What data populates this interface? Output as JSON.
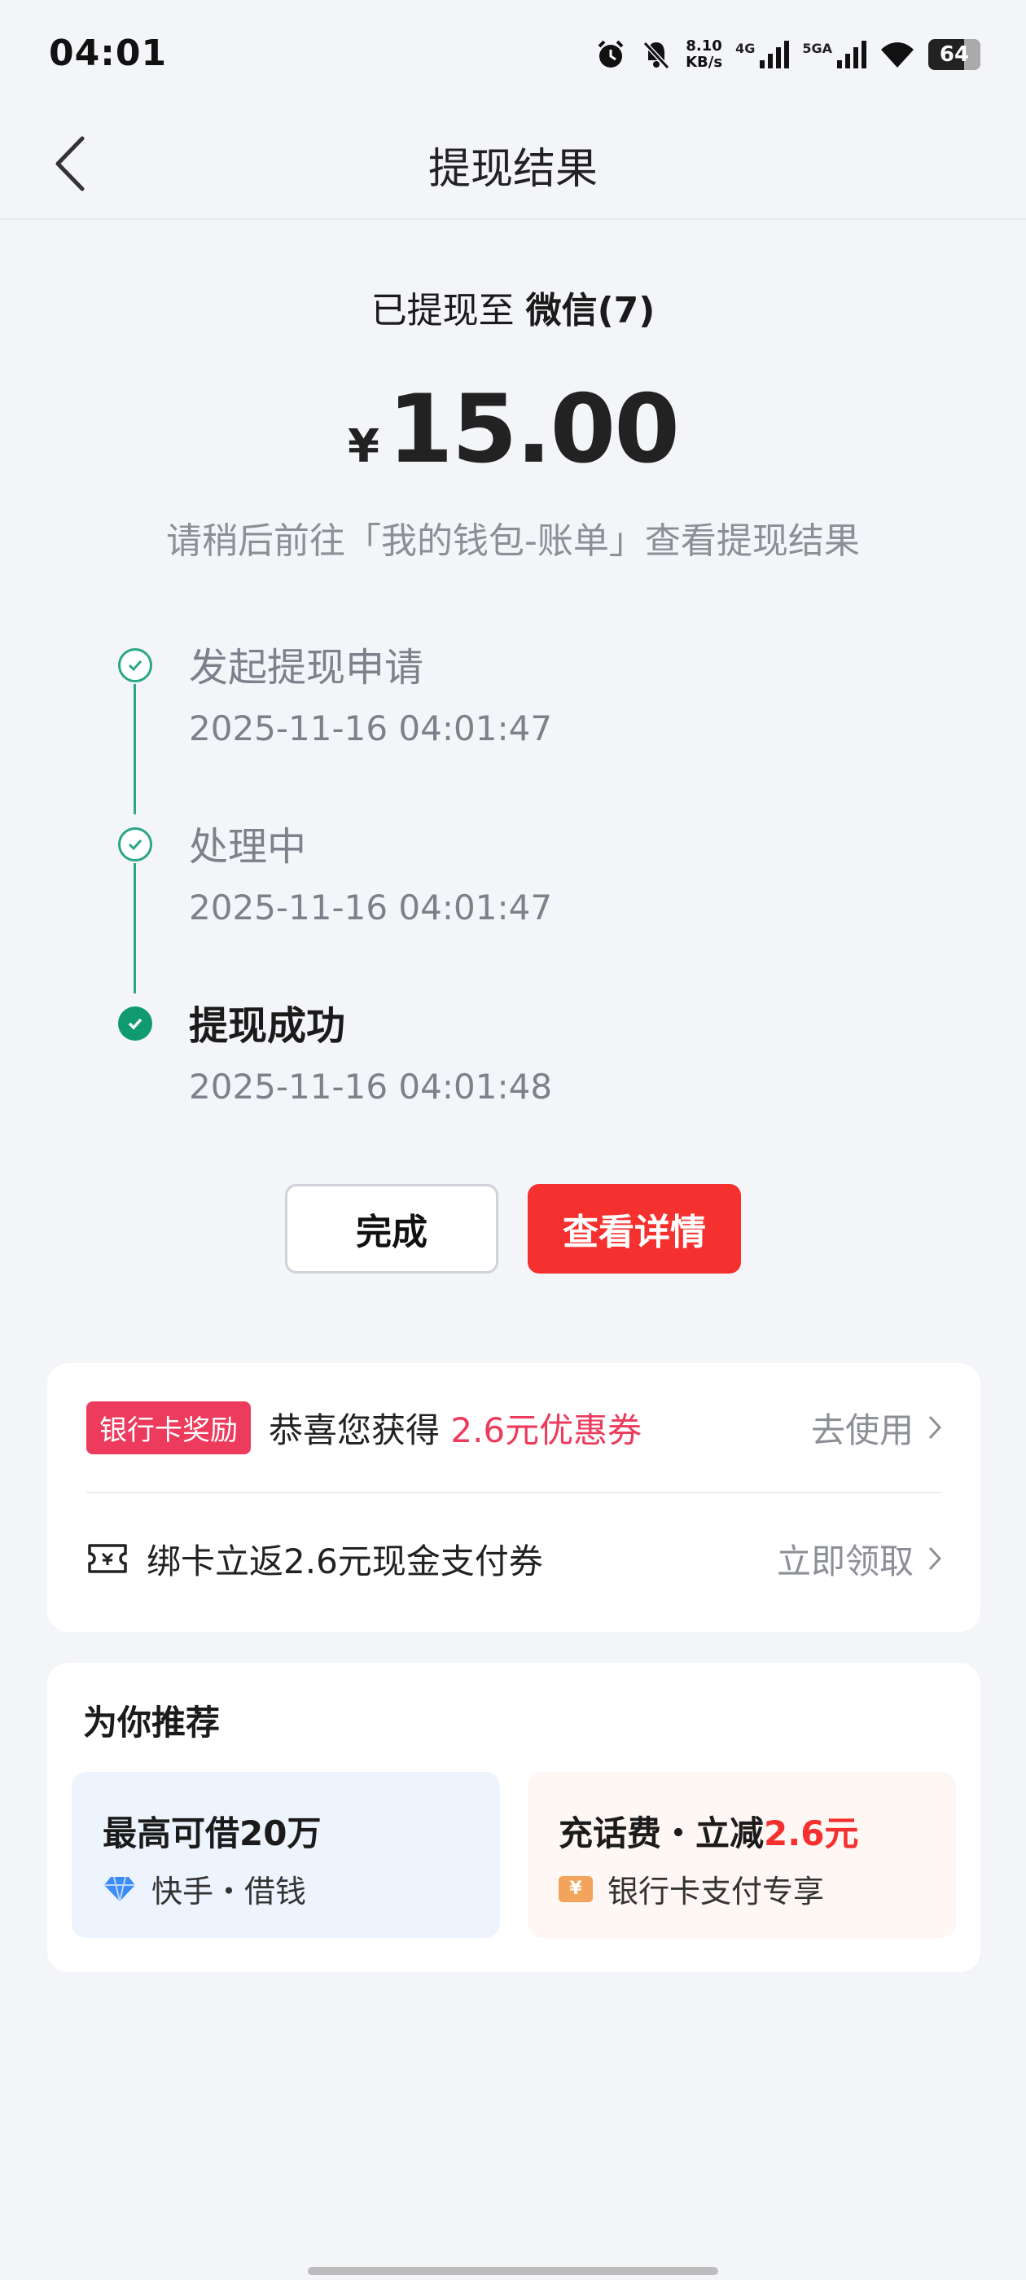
{
  "status_bar": {
    "time": "04:01",
    "net_speed_value": "8.10",
    "net_speed_unit": "KB/s",
    "signal1_label": "4G",
    "signal2_label": "5GA",
    "battery": "64"
  },
  "nav": {
    "title": "提现结果"
  },
  "result": {
    "destination_prefix": "已提现至 ",
    "destination": "微信(7)",
    "currency": "¥",
    "amount": "15.00",
    "hint": "请稍后前往「我的钱包-账单」查看提现结果"
  },
  "timeline": {
    "steps": [
      {
        "title": "发起提现申请",
        "time": "2025-11-16 04:01:47"
      },
      {
        "title": "处理中",
        "time": "2025-11-16 04:01:47"
      },
      {
        "title": "提现成功",
        "time": "2025-11-16 04:01:48"
      }
    ]
  },
  "buttons": {
    "done": "完成",
    "detail": "查看详情"
  },
  "reward": {
    "tag": "银行卡奖励",
    "text_prefix": "恭喜您获得 ",
    "text_highlight": "2.6元优惠券",
    "action": "去使用",
    "bind_text": "绑卡立返2.6元现金支付券",
    "bind_action": "立即领取"
  },
  "recommend": {
    "title": "为你推荐",
    "tiles": [
      {
        "title": "最高可借20万",
        "sub": "快手・借钱",
        "icon": "diamond-icon"
      },
      {
        "title_prefix": "充话费・立减",
        "title_highlight": "2.6元",
        "sub": "银行卡支付专享",
        "icon": "coupon-icon",
        "icon_glyph": "¥"
      }
    ]
  },
  "colors": {
    "accent_red": "#f5312f",
    "highlight_pink": "#ec3b5c",
    "timeline_green": "#0f9a70"
  }
}
